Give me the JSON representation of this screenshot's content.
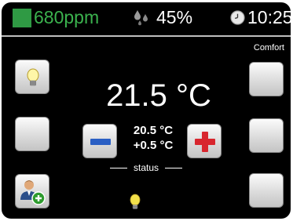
{
  "status_bar": {
    "co2_value": "680ppm",
    "humidity_value": "45%",
    "time": "10:25",
    "co2_color": "#2f9a44"
  },
  "mode": {
    "label": "Comfort"
  },
  "setpoint": {
    "temperature": "21.5 °C"
  },
  "controls": {
    "actual_temperature": "20.5 °C",
    "offset": "+0.5 °C",
    "status_label": "status"
  },
  "icons": {
    "left_top": "light-bulb-icon",
    "left_bottom": "add-user-icon",
    "status_indicator": "light-bulb-icon",
    "humidity": "humidity-drops-icon",
    "clock": "clock-icon"
  },
  "colors": {
    "minus": "#2a5fc4",
    "plus": "#d8262e",
    "accent_green": "#3bb24e"
  }
}
